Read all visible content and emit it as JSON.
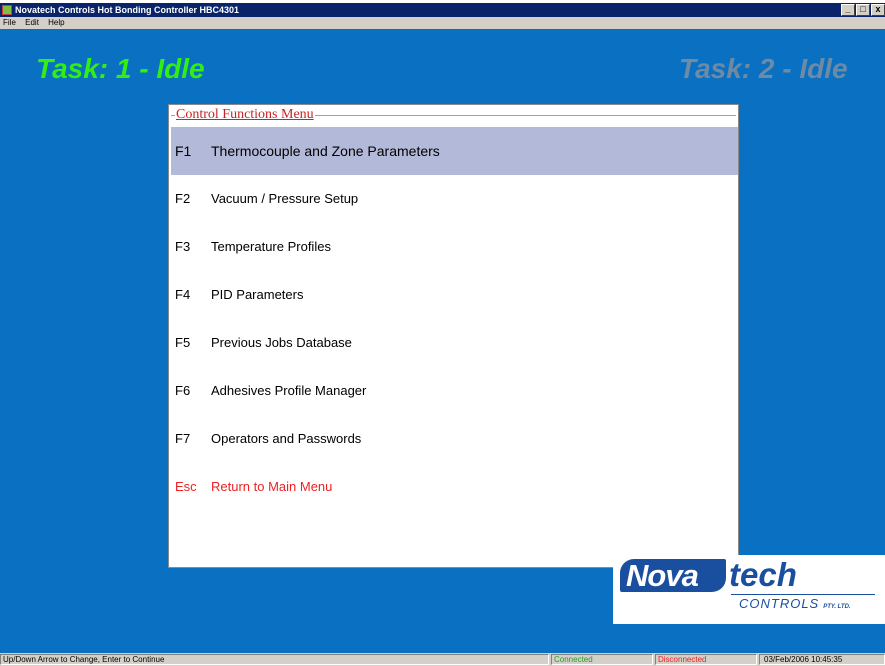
{
  "window": {
    "title": "Novatech Controls Hot Bonding Controller HBC4301",
    "min_label": "_",
    "max_label": "□",
    "close_label": "x"
  },
  "menubar": {
    "items": [
      "File",
      "Edit",
      "Help"
    ]
  },
  "tasks": {
    "task1": "Task: 1 - Idle",
    "task2": "Task: 2 - Idle",
    "task1_color": "#33ee11",
    "task2_color": "#6e8aa4"
  },
  "panel": {
    "legend": "Control Functions Menu",
    "items": [
      {
        "key": "F1",
        "label": "Thermocouple and Zone Parameters"
      },
      {
        "key": "F2",
        "label": "Vacuum / Pressure Setup"
      },
      {
        "key": "F3",
        "label": "Temperature Profiles"
      },
      {
        "key": "F4",
        "label": "PID Parameters"
      },
      {
        "key": "F5",
        "label": "Previous Jobs Database"
      },
      {
        "key": "F6",
        "label": "Adhesives Profile Manager"
      },
      {
        "key": "F7",
        "label": "Operators  and Passwords"
      },
      {
        "key": "Esc",
        "label": "Return to Main Menu"
      }
    ]
  },
  "logo": {
    "part1": "Nova",
    "part2": "tech",
    "sub": "CONTROLS",
    "suffix": "PTY. LTD."
  },
  "statusbar": {
    "hint": "Up/Down Arrow to Change,  Enter to Continue",
    "connected": "Connected",
    "disconnected": "Disconnected",
    "datetime": "03/Feb/2006  10:45:35"
  },
  "colors": {
    "background": "#0a70c2",
    "selected_row": "#b3b9d8",
    "esc_text": "#ee2222",
    "connected": "#2a9a2a",
    "disconnected": "#ee2222"
  }
}
